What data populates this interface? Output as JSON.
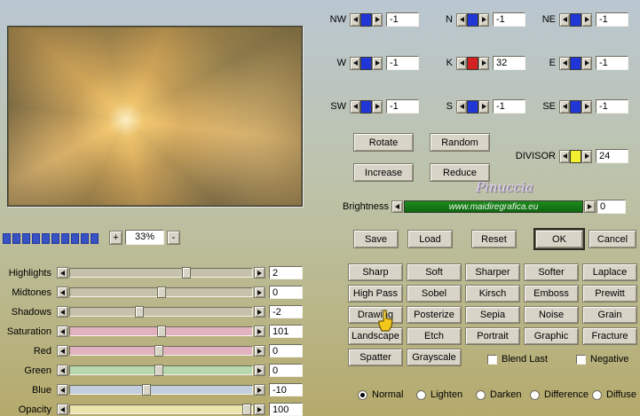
{
  "zoom": {
    "plus": "+",
    "minus": "-",
    "value": "33%"
  },
  "matrix": {
    "cells": [
      {
        "label": "NW",
        "value": "-1",
        "accent": "#2036d6"
      },
      {
        "label": "N",
        "value": "-1",
        "accent": "#2036d6"
      },
      {
        "label": "NE",
        "value": "-1",
        "accent": "#2036d6"
      },
      {
        "label": "W",
        "value": "-1",
        "accent": "#2036d6"
      },
      {
        "label": "K",
        "value": "32",
        "accent": "#d42222"
      },
      {
        "label": "E",
        "value": "-1",
        "accent": "#2036d6"
      },
      {
        "label": "SW",
        "value": "-1",
        "accent": "#2036d6"
      },
      {
        "label": "S",
        "value": "-1",
        "accent": "#2036d6"
      },
      {
        "label": "SE",
        "value": "-1",
        "accent": "#2036d6"
      }
    ],
    "divisor": {
      "label": "DIVISOR",
      "value": "24",
      "accent": "#f4ef2e"
    }
  },
  "actions": {
    "rotate": "Rotate",
    "random": "Random",
    "increase": "Increase",
    "reduce": "Reduce"
  },
  "signature": "Pinuccia",
  "brightness": {
    "label": "Brightness",
    "bar_text": "www.maidiregrafica.eu",
    "value": "0"
  },
  "file_buttons": {
    "save": "Save",
    "load": "Load",
    "reset": "Reset",
    "ok": "OK",
    "cancel": "Cancel"
  },
  "filters": [
    "Sharp",
    "Soft",
    "Sharper",
    "Softer",
    "Laplace",
    "High Pass",
    "Sobel",
    "Kirsch",
    "Emboss",
    "Prewitt",
    "Drawing",
    "Posterize",
    "Sepia",
    "Noise",
    "Grain",
    "Landscape",
    "Etch",
    "Portrait",
    "Graphic",
    "Fracture",
    "Spatter",
    "Grayscale"
  ],
  "checkboxes": [
    {
      "label": "Blend Last",
      "checked": false
    },
    {
      "label": "Negative",
      "checked": false
    }
  ],
  "blend_modes": [
    {
      "label": "Normal",
      "selected": true
    },
    {
      "label": "Lighten",
      "selected": false
    },
    {
      "label": "Darken",
      "selected": false
    },
    {
      "label": "Difference",
      "selected": false
    },
    {
      "label": "Diffuse",
      "selected": false
    }
  ],
  "sliders": [
    {
      "label": "Highlights",
      "value": "2",
      "pos": 64,
      "track_color": "#c6c1ab"
    },
    {
      "label": "Midtones",
      "value": "0",
      "pos": 50,
      "track_color": "#c6c1ab"
    },
    {
      "label": "Shadows",
      "value": "-2",
      "pos": 38,
      "track_color": "#c6c1ab"
    },
    {
      "label": "Saturation",
      "value": "101",
      "pos": 50,
      "track_color": "#e2b2c0"
    },
    {
      "label": "Red",
      "value": "0",
      "pos": 49,
      "track_color": "#e2b2c0"
    },
    {
      "label": "Green",
      "value": "0",
      "pos": 49,
      "track_color": "#b7d7af"
    },
    {
      "label": "Blue",
      "value": "-10",
      "pos": 42,
      "track_color": "#c3cfdf"
    },
    {
      "label": "Opacity",
      "value": "100",
      "pos": 97,
      "track_color": "#ebe5ac"
    }
  ],
  "icons": {
    "cursor": "pointing-hand-icon"
  }
}
